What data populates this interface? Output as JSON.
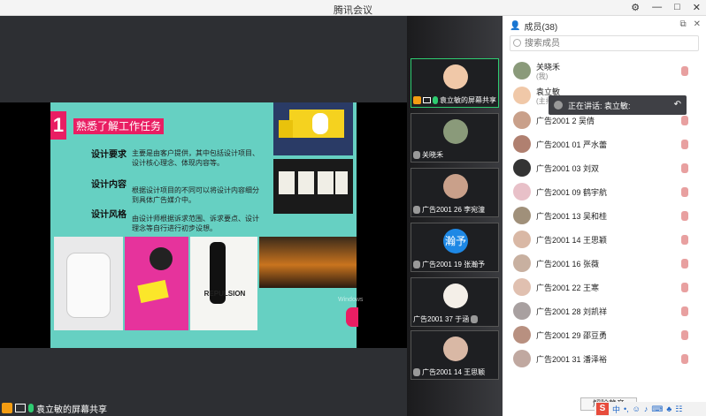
{
  "window": {
    "title": "腾讯会议",
    "controls": [
      "⚙",
      "—",
      "□",
      "✕"
    ]
  },
  "slide": {
    "number": "1",
    "heading": "熟悉了解工作任务",
    "rows": [
      {
        "label": "设计要求",
        "text": "主要是由客户提供，其中包括设计项目、设计核心理念、体现内容等。"
      },
      {
        "label": "设计内容",
        "text": "根据设计项目的不同可以将设计内容细分到具体广告媒介中。"
      },
      {
        "label": "设计风格",
        "text": "由设计师根据诉求范围、诉求要点、设计理念等自行进行初步设想。"
      }
    ],
    "poster_word": "REPULSION",
    "watermark": "Windows"
  },
  "screen_share": {
    "label": "袁立敏的屏幕共享"
  },
  "video_tiles": [
    {
      "name": "袁立敏的屏幕共享",
      "avatar_text": "",
      "active": true
    },
    {
      "name": "关晓禾",
      "avatar_text": "",
      "active": false
    },
    {
      "name": "广告2001 26 李宛潼",
      "avatar_text": "",
      "active": false
    },
    {
      "name": "广告2001 19 张瀚予",
      "avatar_text": "瀚予",
      "active": false
    },
    {
      "name": "广告2001 37 于涵",
      "avatar_text": "",
      "active": false
    },
    {
      "name": "广告2001 14 王思颖",
      "avatar_text": "",
      "active": false
    }
  ],
  "members_panel": {
    "title": "成员(38)",
    "controls": [
      "⧉",
      "✕"
    ],
    "search_placeholder": "搜索成员",
    "members": [
      {
        "name": "关晓禾",
        "sub": "(我)"
      },
      {
        "name": "袁立敏",
        "sub": "(主持人)"
      },
      {
        "name": "广告2001  2 吴倩",
        "sub": ""
      },
      {
        "name": "广告2001 01 严水蕾",
        "sub": ""
      },
      {
        "name": "广告2001 03 刘双",
        "sub": ""
      },
      {
        "name": "广告2001 09 鹤宇航",
        "sub": ""
      },
      {
        "name": "广告2001 13 吴和桂",
        "sub": ""
      },
      {
        "name": "广告2001 14 王思颖",
        "sub": ""
      },
      {
        "name": "广告2001 16 张薇",
        "sub": ""
      },
      {
        "name": "广告2001 22 王寒",
        "sub": ""
      },
      {
        "name": "广告2001 28 刘凯祥",
        "sub": ""
      },
      {
        "name": "广告2001 29 邵豆勇",
        "sub": ""
      },
      {
        "name": "广告2001 31 潘泽裕",
        "sub": ""
      }
    ],
    "unmute_button": "解除静音"
  },
  "speaking_tooltip": {
    "text": "正在讲话: 袁立敏:",
    "back": "↶"
  },
  "ime_bar": {
    "items": [
      "S",
      "中",
      "•,",
      "☺",
      "♪",
      "⌨",
      "♣",
      "☷"
    ]
  },
  "colors": {
    "slide_bg": "#66d0c2",
    "accent_pink": "#e91e63",
    "active_tile": "#2ecc71"
  }
}
